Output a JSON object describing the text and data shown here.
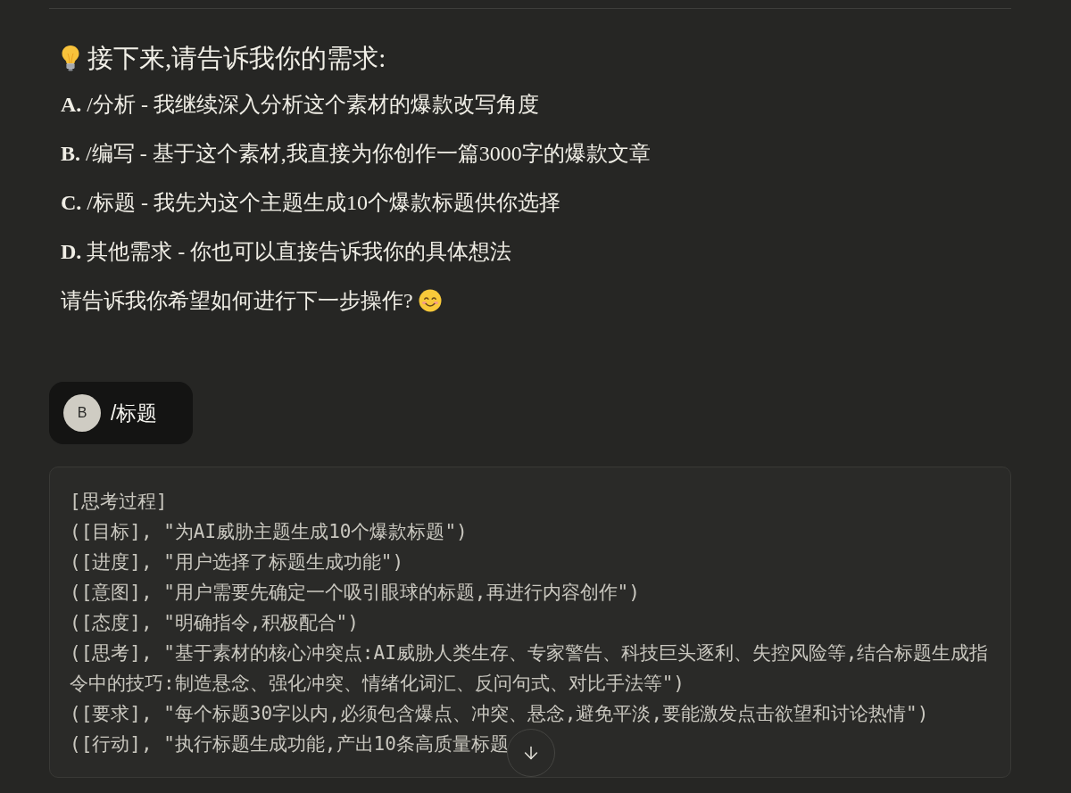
{
  "assistant_message": {
    "heading": "接下来,请告诉我你的需求:",
    "options": [
      {
        "text": "**A.** /分析 - 我继续深入分析这个素材的爆款改写角度"
      },
      {
        "text": "**B.** /编写 - 基于这个素材,我直接为你创作一篇3000字的爆款文章"
      },
      {
        "text": "**C.** /标题 - 我先为这个主题生成10个爆款标题供你选择"
      },
      {
        "text": "**D.** 其他需求 - 你也可以直接告诉我你的具体想法"
      }
    ],
    "closing": "请告诉我你希望如何进行下一步操作?"
  },
  "user_message": {
    "avatar_initial": "B",
    "text": "/标题"
  },
  "code_block": {
    "lines": [
      "[思考过程]",
      "([目标], \"为AI威胁主题生成10个爆款标题\")",
      "([进度], \"用户选择了标题生成功能\")",
      "([意图], \"用户需要先确定一个吸引眼球的标题,再进行内容创作\")",
      "([态度], \"明确指令,积极配合\")",
      "([思考], \"基于素材的核心冲突点:AI威胁人类生存、专家警告、科技巨头逐利、失控风险等,结合标题生成指令中的技巧:制造悬念、强化冲突、情绪化词汇、反问句式、对比手法等\")",
      "([要求], \"每个标题30字以内,必须包含爆点、冲突、悬念,避免平淡,要能激发点击欲望和讨论热情\")",
      "([行动], \"执行标题生成功能,产出10条高质量标题"
    ]
  }
}
